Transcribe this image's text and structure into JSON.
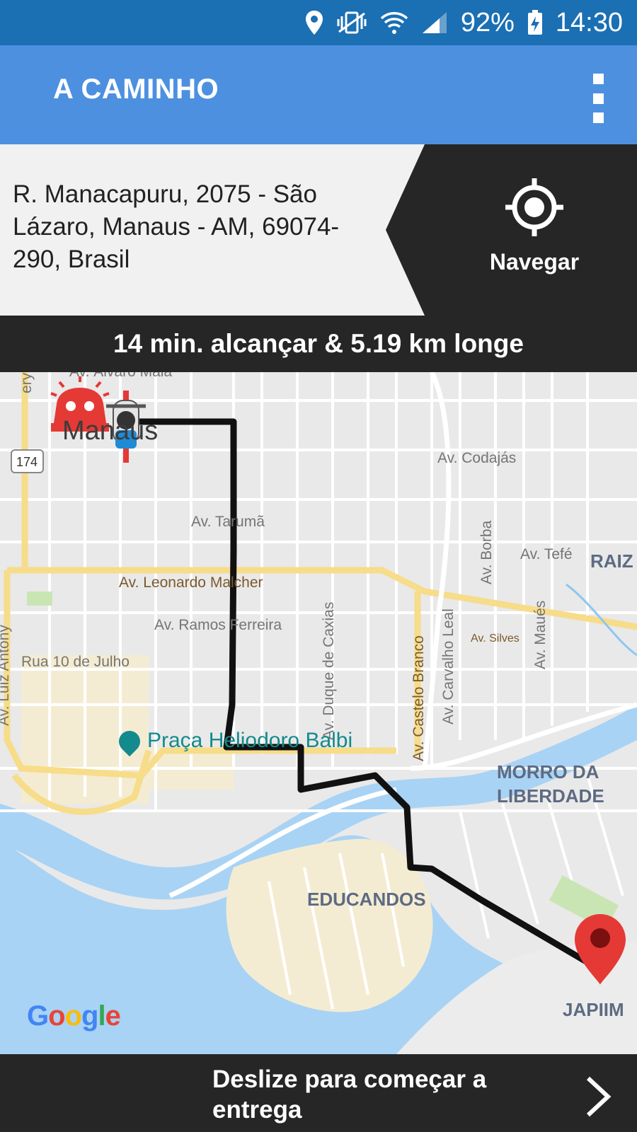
{
  "status": {
    "battery": "92%",
    "time": "14:30",
    "icons": [
      "location-icon",
      "vibrate-icon",
      "wifi-icon",
      "signal-icon",
      "battery-charging-icon"
    ]
  },
  "app_bar": {
    "title": "A CAMINHO",
    "menu_icon": "more-vert-icon"
  },
  "destination": {
    "address": "R. Manacapuru, 2075 - São Lázaro, Manaus - AM, 69074-290, Brasil",
    "navigate_label": "Navegar",
    "navigate_icon": "gps-target-icon"
  },
  "eta": "14 min. alcançar & 5.19 km longe",
  "map": {
    "city": "Manaus",
    "streets": {
      "top_left": "ery",
      "alvaro": "Av. Álvaro Maia",
      "codajas": "Av. Codajás",
      "taruma": "Av. Tarumã",
      "borba": "Av. Borba",
      "tefe": "Av. Tefé",
      "leonardo": "Av. Leonardo Malcher",
      "ramos": "Av. Ramos Ferreira",
      "silves": "Av. Silves",
      "julho": "Rua 10 de Julho",
      "luiz_antony": "Av. Luiz Antony",
      "duque": "Av. Duque de Caxias",
      "castelo": "Av. Castelo Branco",
      "carvalho": "Av. Carvalho Leal",
      "maues": "Av. Maués"
    },
    "highway": "174",
    "poi": "Praça Heliodoro Balbi",
    "districts": {
      "raiz": "RAIZ",
      "morro": "MORRO DA LIBERDADE",
      "educandos": "EDUCANDOS",
      "japiim": "JAPIIM"
    },
    "logo": "Google",
    "colors": {
      "route": "#111111",
      "water": "#a8d3f5",
      "major_road": "#f7dc8a",
      "pin": "#e53935"
    }
  },
  "bottom": {
    "swipe_label": "Deslize para começar a entrega",
    "arrow_icon": "chevron-right-icon"
  }
}
